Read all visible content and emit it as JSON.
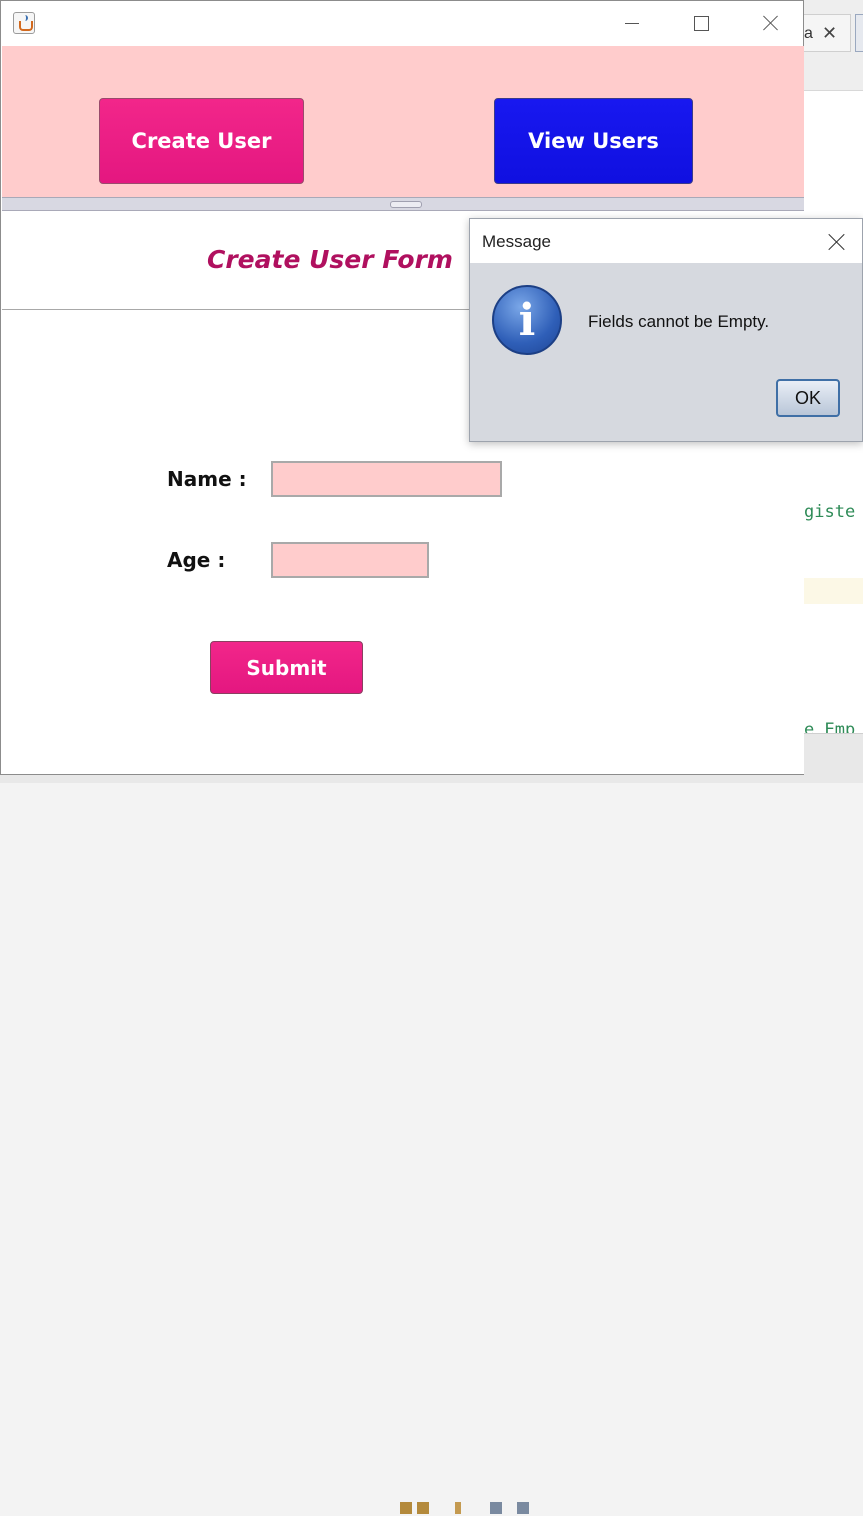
{
  "window": {
    "icon": "java-icon",
    "controls": [
      "minimize-icon",
      "maximize-icon",
      "close-icon"
    ]
  },
  "top_panel": {
    "create_user_label": "Create User",
    "view_users_label": "View Users",
    "create_user_color": "#e8197f",
    "view_users_color": "#1414e8",
    "background": "#ffcccc"
  },
  "form": {
    "title": "Create User Form",
    "title_color": "#b0105f",
    "name_label": "Name :",
    "name_value": "",
    "age_label": "Age :",
    "age_value": "",
    "submit_label": "Submit"
  },
  "dialog": {
    "title": "Message",
    "icon": "info-icon",
    "message": "Fields cannot be Empty.",
    "ok_label": "OK"
  },
  "background_editor": {
    "tab_fragment": "a",
    "code_fragments": [
      "giste",
      "e Emp"
    ]
  }
}
